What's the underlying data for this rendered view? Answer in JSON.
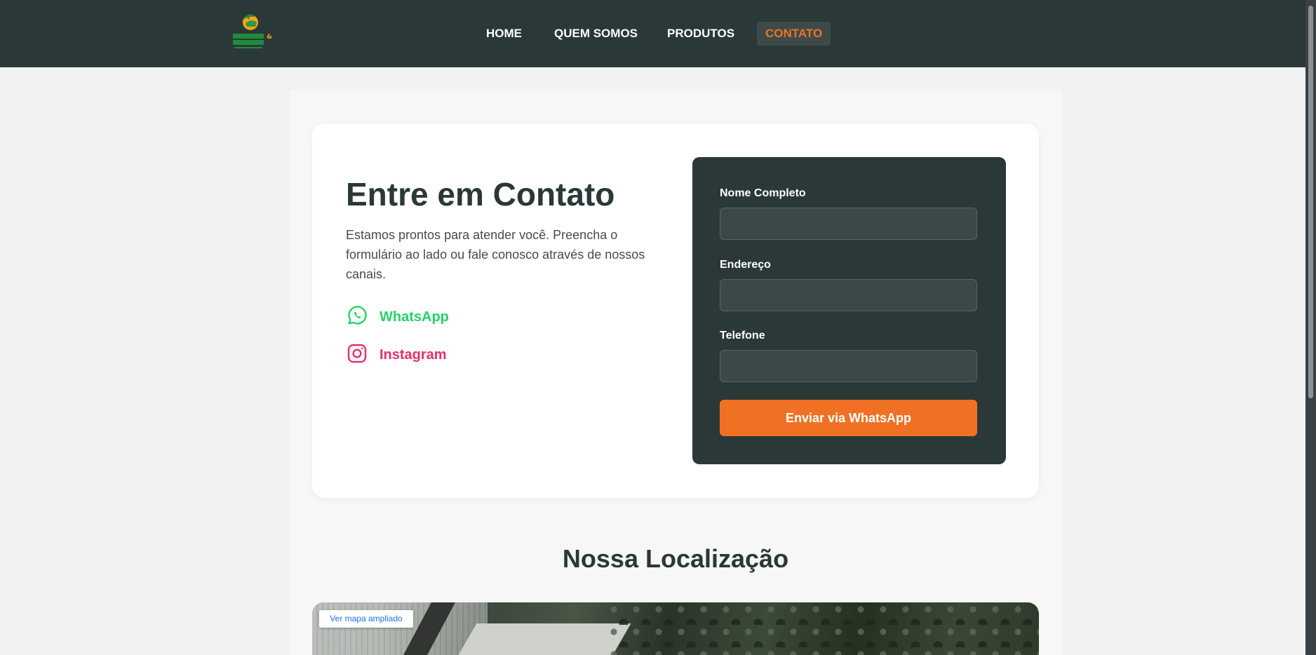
{
  "header": {
    "logo_alt": "Queiroz & Guarilha",
    "nav": [
      {
        "label": "HOME",
        "active": false
      },
      {
        "label": "QUEM SOMOS",
        "active": false
      },
      {
        "label": "PRODUTOS",
        "active": false
      },
      {
        "label": "CONTATO",
        "active": true
      }
    ]
  },
  "contact": {
    "title": "Entre em Contato",
    "description": "Estamos prontos para atender você. Preencha o formulário ao lado ou fale conosco através de nossos canais.",
    "channels": [
      {
        "label": "WhatsApp",
        "icon": "whatsapp-icon",
        "color": "#25d366"
      },
      {
        "label": "Instagram",
        "icon": "instagram-icon",
        "color": "#e1306c"
      }
    ]
  },
  "form": {
    "fields": [
      {
        "label": "Nome Completo",
        "value": "",
        "placeholder": ""
      },
      {
        "label": "Endereço",
        "value": "",
        "placeholder": ""
      },
      {
        "label": "Telefone",
        "value": "",
        "placeholder": ""
      }
    ],
    "submit_label": "Enviar via WhatsApp"
  },
  "location": {
    "title": "Nossa Localização",
    "map_link": "Ver mapa ampliado"
  },
  "colors": {
    "header_bg": "#2a3837",
    "accent": "#f07124",
    "whatsapp": "#25d366",
    "instagram": "#e1306c"
  }
}
